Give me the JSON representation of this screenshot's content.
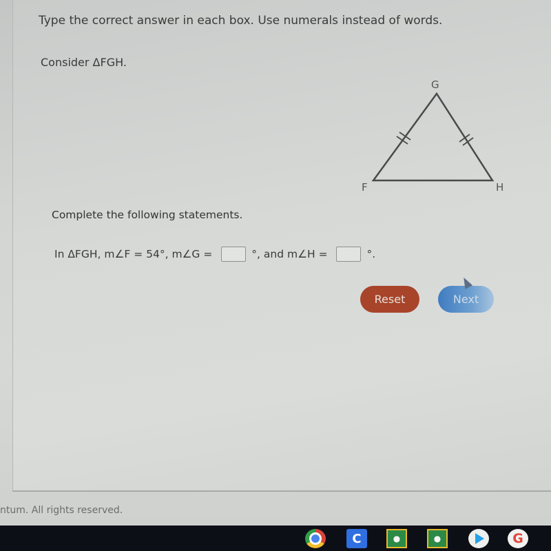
{
  "question": {
    "instructions": "Type the correct answer in each box. Use numerals instead of words.",
    "consider": "Consider ΔFGH.",
    "figure": {
      "vertices": [
        "F",
        "G",
        "H"
      ],
      "congruent_sides": [
        "FG",
        "GH"
      ],
      "tick_marks_per_side": 2
    },
    "complete_prompt": "Complete the following statements.",
    "statement": {
      "part1": "In ΔFGH, m∠F = 54°, m∠G = ",
      "part2": "°, and m∠H = ",
      "part3": "°.",
      "given_angle_F": 54
    },
    "answers": {
      "angle_G": "",
      "angle_H": ""
    }
  },
  "buttons": {
    "reset_label": "Reset",
    "next_label": "Next"
  },
  "footer": {
    "copyright": "ntum. All rights reserved."
  },
  "shelf": {
    "apps": [
      "chrome-icon",
      "c-app-icon",
      "google-classroom-icon",
      "google-classroom-icon",
      "play-store-icon",
      "google-icon"
    ],
    "c_app_letter": "C",
    "google_letter": "G"
  },
  "colors": {
    "reset": "#a8442a",
    "next": "#4f86c6"
  }
}
